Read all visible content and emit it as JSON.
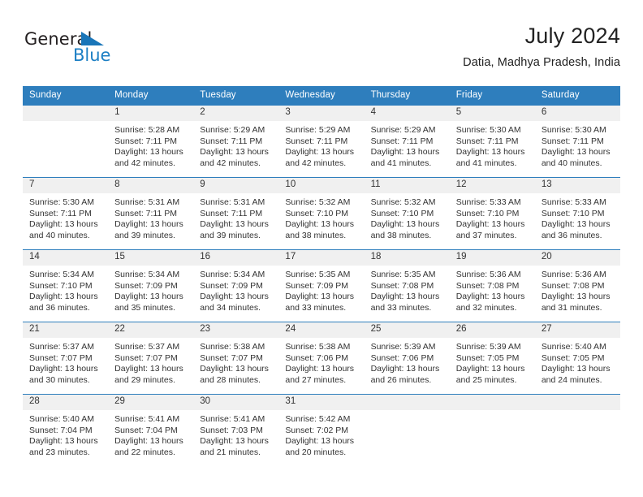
{
  "brand": {
    "name_part1": "General",
    "name_part2": "Blue",
    "logo_icon": "blue-triangle-icon"
  },
  "header": {
    "title": "July 2024",
    "subtitle": "Datia, Madhya Pradesh, India"
  },
  "theme": {
    "header_blue": "#2e7ebd",
    "brand_blue": "#1c7fc4",
    "daynum_band": "#f0f0f0",
    "text": "#333333"
  },
  "weekday_headers": [
    "Sunday",
    "Monday",
    "Tuesday",
    "Wednesday",
    "Thursday",
    "Friday",
    "Saturday"
  ],
  "weeks": [
    [
      {
        "day": "",
        "sunrise": "",
        "sunset": "",
        "daylight_line1": "",
        "daylight_line2": ""
      },
      {
        "day": "1",
        "sunrise": "Sunrise: 5:28 AM",
        "sunset": "Sunset: 7:11 PM",
        "daylight_line1": "Daylight: 13 hours",
        "daylight_line2": "and 42 minutes."
      },
      {
        "day": "2",
        "sunrise": "Sunrise: 5:29 AM",
        "sunset": "Sunset: 7:11 PM",
        "daylight_line1": "Daylight: 13 hours",
        "daylight_line2": "and 42 minutes."
      },
      {
        "day": "3",
        "sunrise": "Sunrise: 5:29 AM",
        "sunset": "Sunset: 7:11 PM",
        "daylight_line1": "Daylight: 13 hours",
        "daylight_line2": "and 42 minutes."
      },
      {
        "day": "4",
        "sunrise": "Sunrise: 5:29 AM",
        "sunset": "Sunset: 7:11 PM",
        "daylight_line1": "Daylight: 13 hours",
        "daylight_line2": "and 41 minutes."
      },
      {
        "day": "5",
        "sunrise": "Sunrise: 5:30 AM",
        "sunset": "Sunset: 7:11 PM",
        "daylight_line1": "Daylight: 13 hours",
        "daylight_line2": "and 41 minutes."
      },
      {
        "day": "6",
        "sunrise": "Sunrise: 5:30 AM",
        "sunset": "Sunset: 7:11 PM",
        "daylight_line1": "Daylight: 13 hours",
        "daylight_line2": "and 40 minutes."
      }
    ],
    [
      {
        "day": "7",
        "sunrise": "Sunrise: 5:30 AM",
        "sunset": "Sunset: 7:11 PM",
        "daylight_line1": "Daylight: 13 hours",
        "daylight_line2": "and 40 minutes."
      },
      {
        "day": "8",
        "sunrise": "Sunrise: 5:31 AM",
        "sunset": "Sunset: 7:11 PM",
        "daylight_line1": "Daylight: 13 hours",
        "daylight_line2": "and 39 minutes."
      },
      {
        "day": "9",
        "sunrise": "Sunrise: 5:31 AM",
        "sunset": "Sunset: 7:11 PM",
        "daylight_line1": "Daylight: 13 hours",
        "daylight_line2": "and 39 minutes."
      },
      {
        "day": "10",
        "sunrise": "Sunrise: 5:32 AM",
        "sunset": "Sunset: 7:10 PM",
        "daylight_line1": "Daylight: 13 hours",
        "daylight_line2": "and 38 minutes."
      },
      {
        "day": "11",
        "sunrise": "Sunrise: 5:32 AM",
        "sunset": "Sunset: 7:10 PM",
        "daylight_line1": "Daylight: 13 hours",
        "daylight_line2": "and 38 minutes."
      },
      {
        "day": "12",
        "sunrise": "Sunrise: 5:33 AM",
        "sunset": "Sunset: 7:10 PM",
        "daylight_line1": "Daylight: 13 hours",
        "daylight_line2": "and 37 minutes."
      },
      {
        "day": "13",
        "sunrise": "Sunrise: 5:33 AM",
        "sunset": "Sunset: 7:10 PM",
        "daylight_line1": "Daylight: 13 hours",
        "daylight_line2": "and 36 minutes."
      }
    ],
    [
      {
        "day": "14",
        "sunrise": "Sunrise: 5:34 AM",
        "sunset": "Sunset: 7:10 PM",
        "daylight_line1": "Daylight: 13 hours",
        "daylight_line2": "and 36 minutes."
      },
      {
        "day": "15",
        "sunrise": "Sunrise: 5:34 AM",
        "sunset": "Sunset: 7:09 PM",
        "daylight_line1": "Daylight: 13 hours",
        "daylight_line2": "and 35 minutes."
      },
      {
        "day": "16",
        "sunrise": "Sunrise: 5:34 AM",
        "sunset": "Sunset: 7:09 PM",
        "daylight_line1": "Daylight: 13 hours",
        "daylight_line2": "and 34 minutes."
      },
      {
        "day": "17",
        "sunrise": "Sunrise: 5:35 AM",
        "sunset": "Sunset: 7:09 PM",
        "daylight_line1": "Daylight: 13 hours",
        "daylight_line2": "and 33 minutes."
      },
      {
        "day": "18",
        "sunrise": "Sunrise: 5:35 AM",
        "sunset": "Sunset: 7:08 PM",
        "daylight_line1": "Daylight: 13 hours",
        "daylight_line2": "and 33 minutes."
      },
      {
        "day": "19",
        "sunrise": "Sunrise: 5:36 AM",
        "sunset": "Sunset: 7:08 PM",
        "daylight_line1": "Daylight: 13 hours",
        "daylight_line2": "and 32 minutes."
      },
      {
        "day": "20",
        "sunrise": "Sunrise: 5:36 AM",
        "sunset": "Sunset: 7:08 PM",
        "daylight_line1": "Daylight: 13 hours",
        "daylight_line2": "and 31 minutes."
      }
    ],
    [
      {
        "day": "21",
        "sunrise": "Sunrise: 5:37 AM",
        "sunset": "Sunset: 7:07 PM",
        "daylight_line1": "Daylight: 13 hours",
        "daylight_line2": "and 30 minutes."
      },
      {
        "day": "22",
        "sunrise": "Sunrise: 5:37 AM",
        "sunset": "Sunset: 7:07 PM",
        "daylight_line1": "Daylight: 13 hours",
        "daylight_line2": "and 29 minutes."
      },
      {
        "day": "23",
        "sunrise": "Sunrise: 5:38 AM",
        "sunset": "Sunset: 7:07 PM",
        "daylight_line1": "Daylight: 13 hours",
        "daylight_line2": "and 28 minutes."
      },
      {
        "day": "24",
        "sunrise": "Sunrise: 5:38 AM",
        "sunset": "Sunset: 7:06 PM",
        "daylight_line1": "Daylight: 13 hours",
        "daylight_line2": "and 27 minutes."
      },
      {
        "day": "25",
        "sunrise": "Sunrise: 5:39 AM",
        "sunset": "Sunset: 7:06 PM",
        "daylight_line1": "Daylight: 13 hours",
        "daylight_line2": "and 26 minutes."
      },
      {
        "day": "26",
        "sunrise": "Sunrise: 5:39 AM",
        "sunset": "Sunset: 7:05 PM",
        "daylight_line1": "Daylight: 13 hours",
        "daylight_line2": "and 25 minutes."
      },
      {
        "day": "27",
        "sunrise": "Sunrise: 5:40 AM",
        "sunset": "Sunset: 7:05 PM",
        "daylight_line1": "Daylight: 13 hours",
        "daylight_line2": "and 24 minutes."
      }
    ],
    [
      {
        "day": "28",
        "sunrise": "Sunrise: 5:40 AM",
        "sunset": "Sunset: 7:04 PM",
        "daylight_line1": "Daylight: 13 hours",
        "daylight_line2": "and 23 minutes."
      },
      {
        "day": "29",
        "sunrise": "Sunrise: 5:41 AM",
        "sunset": "Sunset: 7:04 PM",
        "daylight_line1": "Daylight: 13 hours",
        "daylight_line2": "and 22 minutes."
      },
      {
        "day": "30",
        "sunrise": "Sunrise: 5:41 AM",
        "sunset": "Sunset: 7:03 PM",
        "daylight_line1": "Daylight: 13 hours",
        "daylight_line2": "and 21 minutes."
      },
      {
        "day": "31",
        "sunrise": "Sunrise: 5:42 AM",
        "sunset": "Sunset: 7:02 PM",
        "daylight_line1": "Daylight: 13 hours",
        "daylight_line2": "and 20 minutes."
      },
      {
        "day": "",
        "sunrise": "",
        "sunset": "",
        "daylight_line1": "",
        "daylight_line2": ""
      },
      {
        "day": "",
        "sunrise": "",
        "sunset": "",
        "daylight_line1": "",
        "daylight_line2": ""
      },
      {
        "day": "",
        "sunrise": "",
        "sunset": "",
        "daylight_line1": "",
        "daylight_line2": ""
      }
    ]
  ]
}
